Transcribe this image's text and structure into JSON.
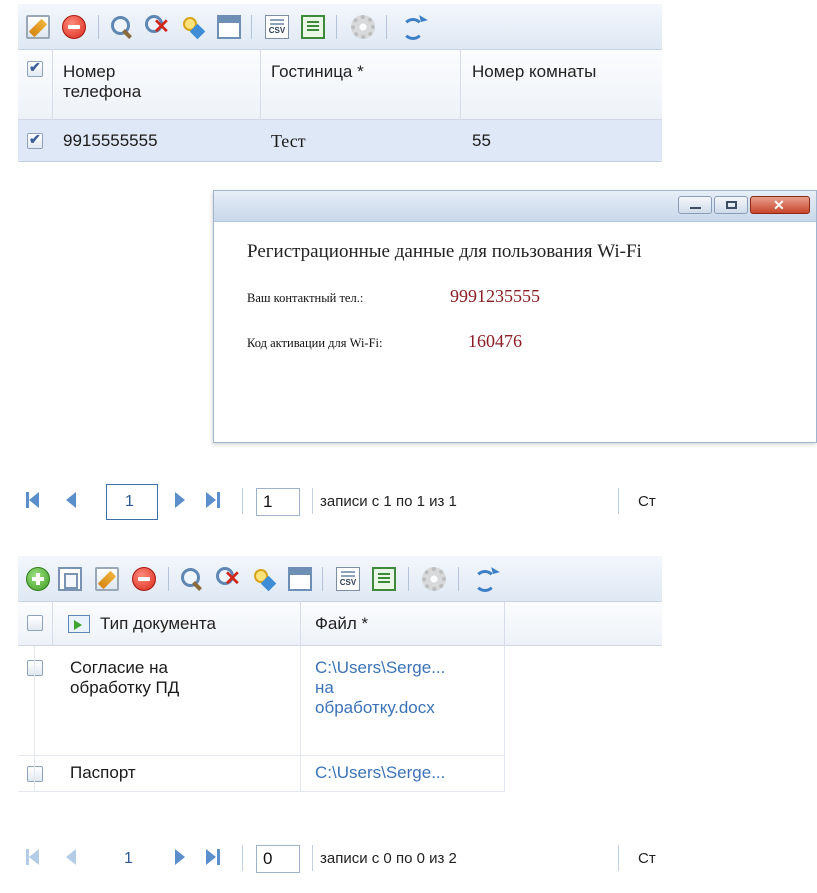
{
  "grid1": {
    "columns": [
      "Номер\nтелефона",
      "Гостиница *",
      "Номер комнаты"
    ],
    "rows": [
      {
        "phone": "9915555555",
        "hotel": "Тест",
        "room": "55"
      }
    ]
  },
  "dialog": {
    "heading": "Регистрационные данные для пользования Wi-Fi",
    "phone_label": "Ваш контактный тел.:",
    "phone_value": "9991235555",
    "code_label": "Код активации для Wi-Fi:",
    "code_value": "160476"
  },
  "pager1": {
    "current_page": "1",
    "page_input": "1",
    "records_text": "записи с 1 по 1 из 1",
    "right_text": "Ст"
  },
  "grid2": {
    "columns": [
      "Тип документа",
      "Файл *"
    ],
    "rows": [
      {
        "type": "Согласие на\nобработку ПД",
        "file": "C:\\Users\\Serge...\nна\nобработку.docx"
      },
      {
        "type": "Паспорт",
        "file": "C:\\Users\\Serge..."
      }
    ]
  },
  "pager2": {
    "current_page": "1",
    "page_input": "0",
    "records_text": "записи с 0 по 0 из 2",
    "right_text": "Ст"
  },
  "icons": {
    "toolbar1": [
      "edit-icon",
      "delete-icon",
      "search-icon",
      "clear-search-icon",
      "filter-icon",
      "window-icon",
      "export-csv-icon",
      "export-excel-icon",
      "settings-icon",
      "refresh-icon"
    ],
    "toolbar2": [
      "add-icon",
      "copy-icon",
      "edit-icon",
      "delete-icon",
      "search-icon",
      "clear-search-icon",
      "filter-icon",
      "window-icon",
      "export-csv-icon",
      "export-excel-icon",
      "settings-icon",
      "refresh-icon"
    ]
  },
  "colors": {
    "accent": "#3b73b8",
    "dialog_value": "#8b1d24",
    "selected_row": "#dfe8f6",
    "toolbar_bg": "#dfe8f4"
  }
}
